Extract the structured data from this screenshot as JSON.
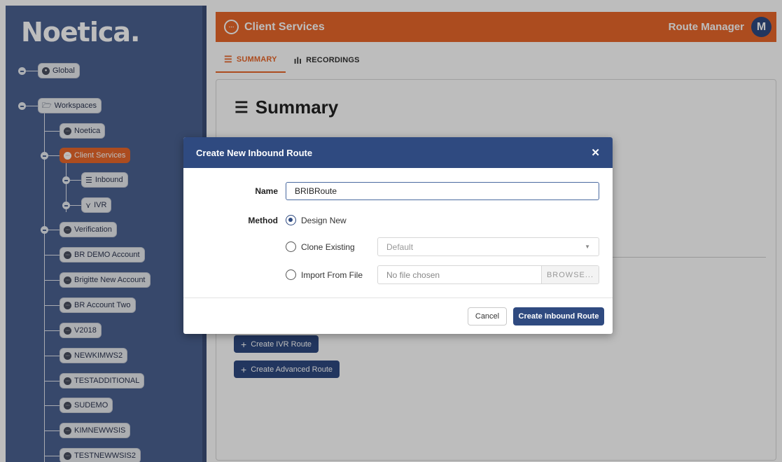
{
  "sidebar": {
    "logo": "Noetica.",
    "global": {
      "label": "Global",
      "icon": "globe-icon"
    },
    "workspaces": {
      "label": "Workspaces",
      "icon": "folder-open-icon"
    },
    "items": [
      {
        "label": "Noetica",
        "icon": "workspace-icon"
      },
      {
        "label": "Client Services",
        "icon": "workspace-icon",
        "active": true
      },
      {
        "label": "Inbound",
        "icon": "inbound-list-icon"
      },
      {
        "label": "IVR",
        "icon": "ivr-flow-icon"
      },
      {
        "label": "Verification",
        "icon": "workspace-icon"
      },
      {
        "label": "BR DEMO Account",
        "icon": "workspace-icon"
      },
      {
        "label": "Brigitte New Account",
        "icon": "workspace-icon"
      },
      {
        "label": "BR Account Two",
        "icon": "workspace-icon"
      },
      {
        "label": "V2018",
        "icon": "workspace-icon"
      },
      {
        "label": "NEWKIMWS2",
        "icon": "workspace-icon"
      },
      {
        "label": "TESTADDITIONAL",
        "icon": "workspace-icon"
      },
      {
        "label": "SUDEMO",
        "icon": "workspace-icon"
      },
      {
        "label": "KIMNEWWSIS",
        "icon": "workspace-icon"
      },
      {
        "label": "TESTNEWWSIS2",
        "icon": "workspace-icon"
      }
    ]
  },
  "header": {
    "title": "Client Services",
    "role": "Route Manager",
    "avatar_initial": "M",
    "accent_color": "#e8672a"
  },
  "tabs": [
    {
      "label": "SUMMARY",
      "icon": "list-icon",
      "active": true
    },
    {
      "label": "RECORDINGS",
      "icon": "audio-wave-icon",
      "active": false
    }
  ],
  "main": {
    "title": "Summary",
    "buttons": {
      "ivr": "Create IVR Route",
      "advanced": "Create Advanced Route"
    }
  },
  "dialog": {
    "title": "Create New Inbound Route",
    "name_label": "Name",
    "name_value": "BRIBRoute",
    "method_label": "Method",
    "options": {
      "design_new": "Design New",
      "clone_existing": "Clone Existing",
      "import_file": "Import From File"
    },
    "selected_method": "Design New",
    "clone_select_value": "Default",
    "file_placeholder": "No file chosen",
    "browse_label": "BROWSE...",
    "cancel_label": "Cancel",
    "create_label": "Create Inbound Route",
    "header_color": "#2f4a80"
  }
}
